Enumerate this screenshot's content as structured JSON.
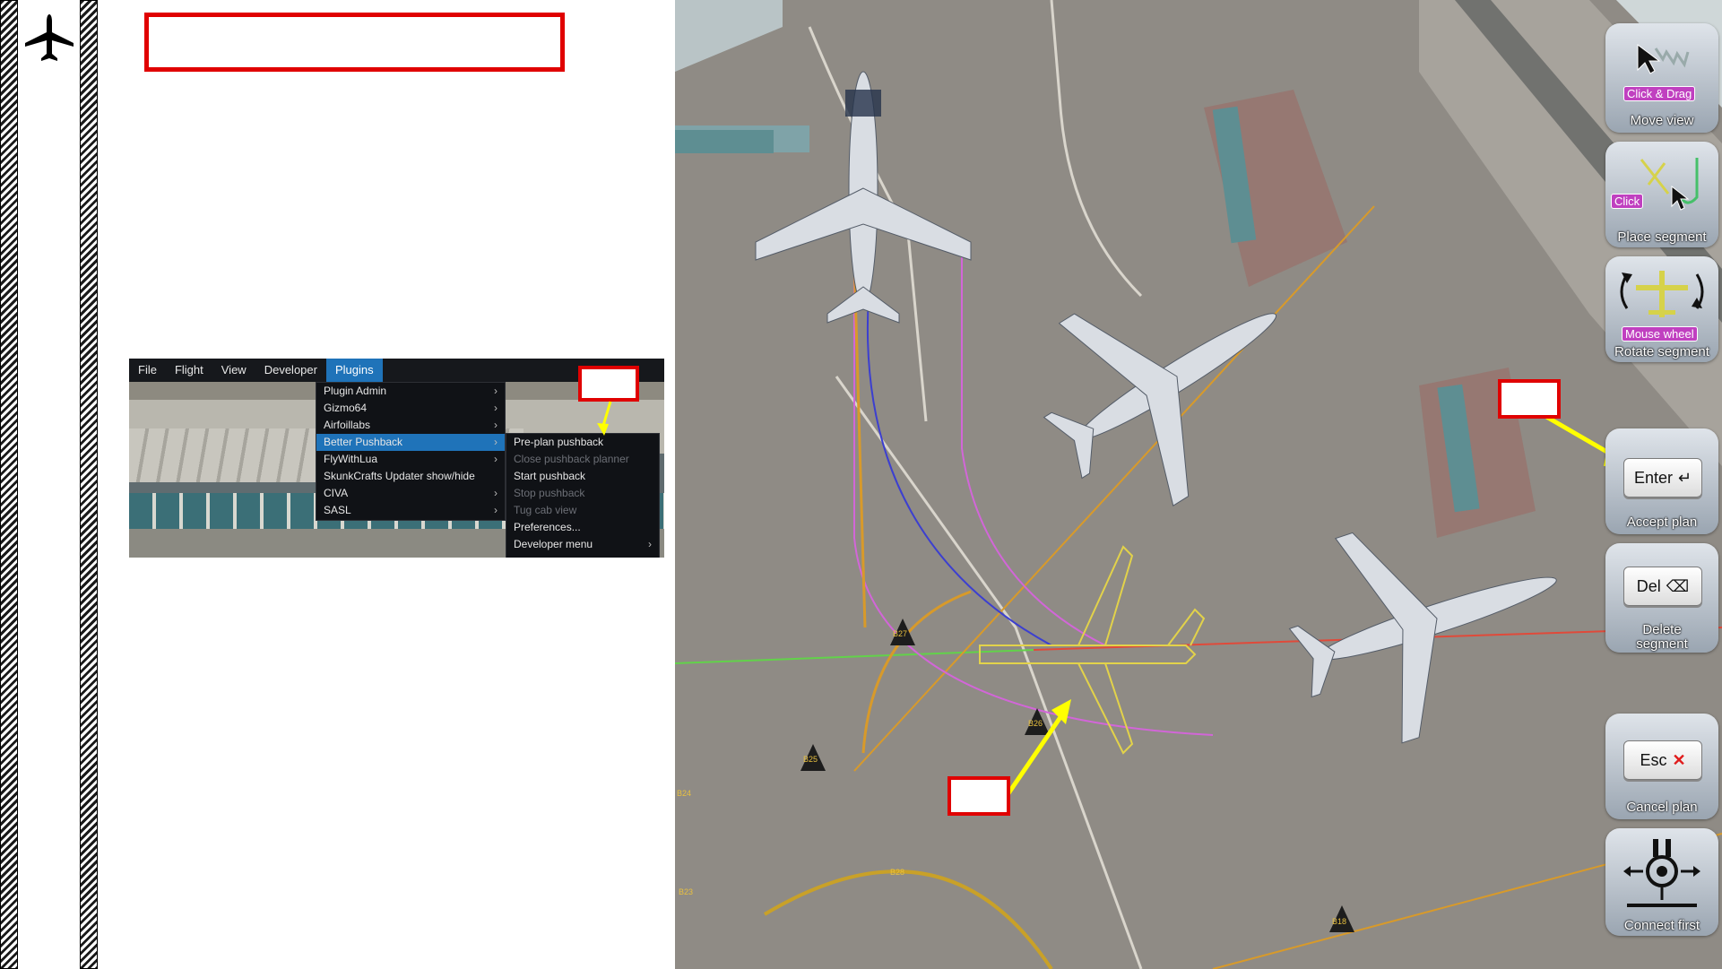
{
  "menu": {
    "bar": [
      "File",
      "Flight",
      "View",
      "Developer",
      "Plugins"
    ],
    "plugins_items": [
      "Plugin Admin",
      "Gizmo64",
      "Airfoillabs",
      "Better Pushback",
      "FlyWithLua",
      "SkunkCrafts Updater show/hide",
      "CIVA",
      "SASL"
    ],
    "submenu_items": [
      "Pre-plan pushback",
      "Close pushback planner",
      "Start pushback",
      "Stop pushback",
      "Tug cab view",
      "Preferences...",
      "Developer menu"
    ]
  },
  "controls": {
    "move_tag": "Click & Drag",
    "move_label": "Move view",
    "place_tag": "Click",
    "place_label": "Place segment",
    "rotate_tag": "Mouse wheel",
    "rotate_label": "Rotate segment",
    "accept_key": "Enter",
    "accept_label": "Accept plan",
    "delete_key": "Del",
    "delete_label_1": "Delete",
    "delete_label_2": "segment",
    "cancel_key": "Esc",
    "cancel_label": "Cancel plan",
    "connect_label": "Connect first"
  },
  "map_labels": [
    "B27",
    "B26",
    "B25",
    "B24",
    "B28",
    "B23",
    "B18"
  ],
  "colors": {
    "callout_border": "#e00000",
    "arrow": "#ffff00",
    "highlight": "#1f73b9",
    "tag": "#c040c0"
  }
}
